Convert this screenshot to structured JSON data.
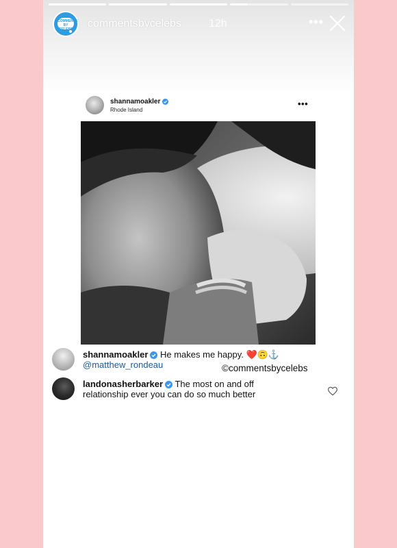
{
  "story": {
    "username": "commentsbycelebs",
    "time": "12h",
    "avatar_text_line1": "COMMENTS",
    "avatar_text_line2": "BY CELEBS",
    "progress_segments": 5,
    "progress_completed": 3.3
  },
  "post": {
    "username": "shannamoakler",
    "location": "Rhode Island"
  },
  "comments": [
    {
      "username": "shannamoakler",
      "text": "He makes me happy. ❤️🙃⚓",
      "mention": "@matthew_rondeau"
    },
    {
      "username": "landonasherbarker",
      "text": "The most on and off",
      "text_line2": "relationship ever you can do so much better"
    }
  ],
  "watermark": "©commentsbycelebs",
  "colors": {
    "background": "#f9c9cb",
    "brand_blue": "#2f9be0",
    "verified_blue": "#3897f0",
    "mention_blue": "#1c5aa0"
  }
}
